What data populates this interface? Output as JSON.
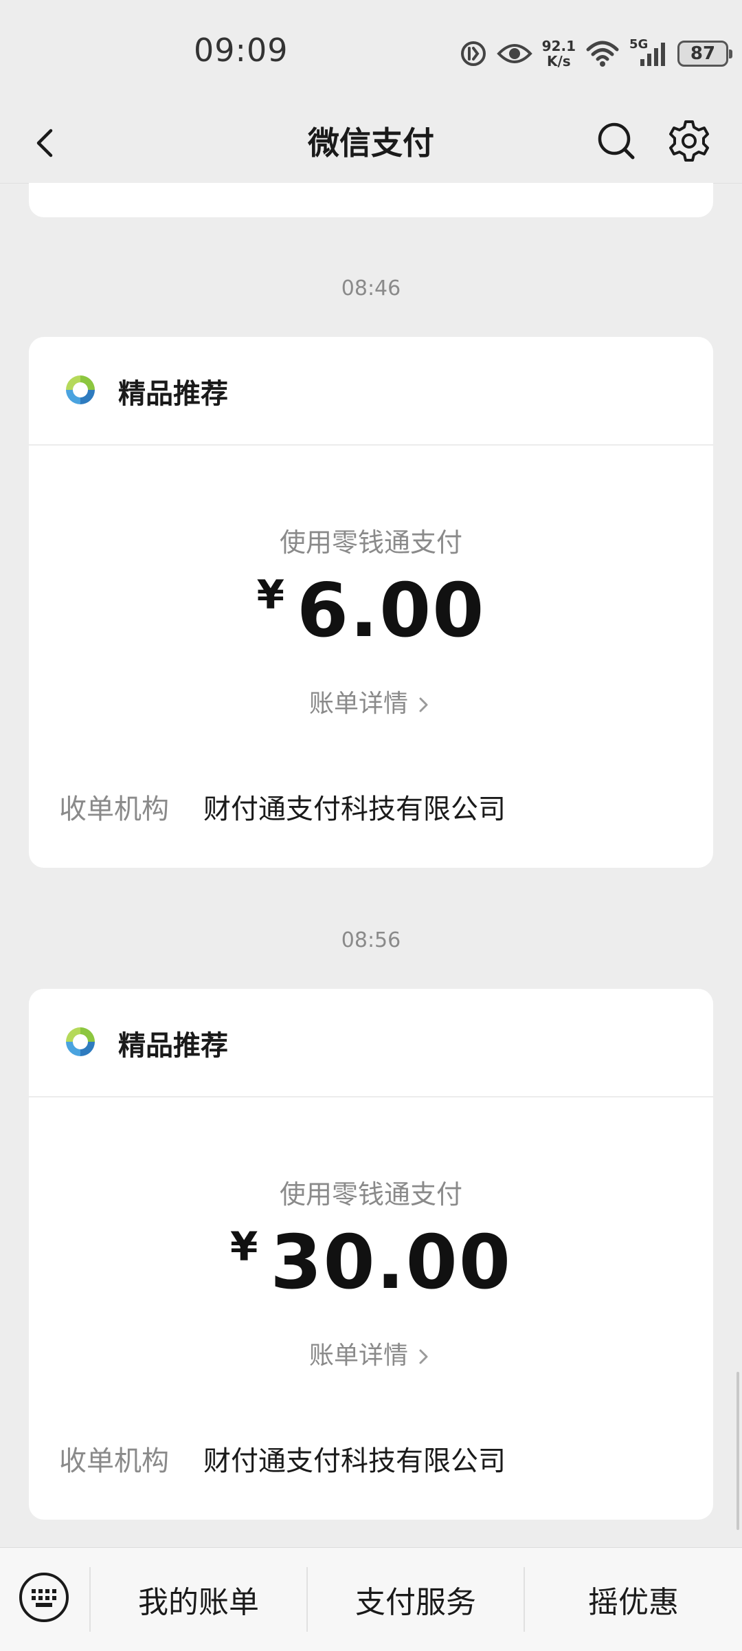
{
  "status_bar": {
    "time": "09:09",
    "net_speed_value": "92.1",
    "net_speed_unit": "K/s",
    "network_type": "5G",
    "battery": "87"
  },
  "nav": {
    "title": "微信支付"
  },
  "messages": [
    {
      "time": "08:46",
      "source": "精品推荐",
      "pay_method": "使用零钱通支付",
      "currency": "¥",
      "amount": "6.00",
      "detail_link": "账单详情",
      "merchant_label": "收单机构",
      "merchant_value": "财付通支付科技有限公司"
    },
    {
      "time": "08:56",
      "source": "精品推荐",
      "pay_method": "使用零钱通支付",
      "currency": "¥",
      "amount": "30.00",
      "detail_link": "账单详情",
      "merchant_label": "收单机构",
      "merchant_value": "财付通支付科技有限公司"
    }
  ],
  "bottom_menu": {
    "items": [
      "我的账单",
      "支付服务",
      "摇优惠"
    ]
  },
  "colors": {
    "background": "#ededed",
    "card": "#ffffff",
    "secondary_text": "#8a8a8a",
    "primary_text": "#1a1a1a"
  },
  "icons": {
    "back": "chevron-left-icon",
    "search": "search-icon",
    "settings": "gear-icon",
    "keyboard": "keyboard-icon",
    "source_logo": "product-logo-icon"
  }
}
